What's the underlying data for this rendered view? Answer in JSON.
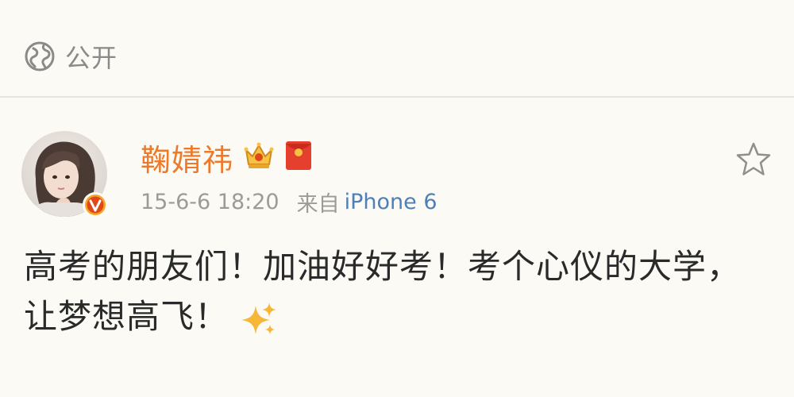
{
  "visibility": {
    "label": "公开",
    "icon": "globe-icon"
  },
  "post": {
    "author": {
      "name": "鞠婧祎",
      "verified": true,
      "badges": [
        "crown-icon",
        "red-envelope-icon"
      ]
    },
    "timestamp": "15-6-6 18:20",
    "source_prefix": "来自",
    "source_device": "iPhone 6",
    "content": "高考的朋友们！加油好好考！考个心仪的大学，让梦想高飞！",
    "emoji": "sparkle-icon"
  },
  "colors": {
    "background": "#fbfaf5",
    "username": "#ec7a2a",
    "source_link": "#4f7fb8",
    "meta_text": "#9b9b98",
    "body_text": "#2a2a2a"
  }
}
